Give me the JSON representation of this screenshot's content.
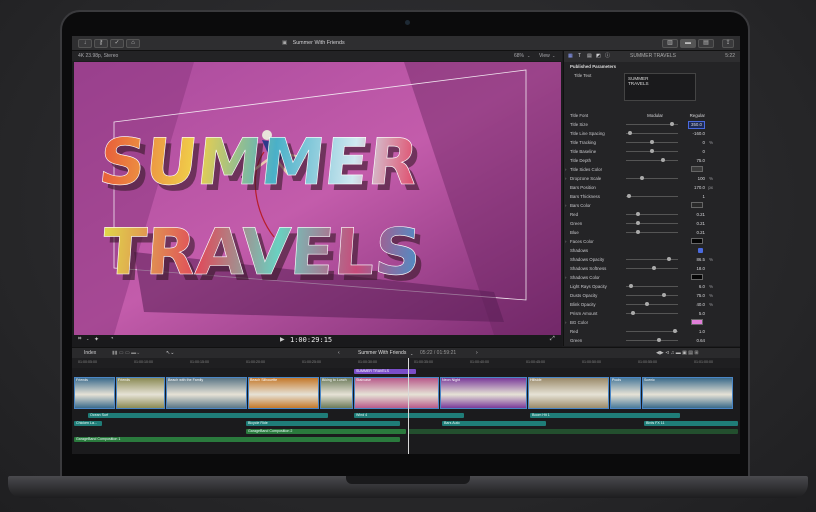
{
  "toolbar": {
    "project_title": "Summer With Friends",
    "format": "4K 23.98p, Stereo",
    "zoom": "68%",
    "view_label": "View",
    "inspector_title": "SUMMER TRAVELS",
    "inspector_time": "5:22"
  },
  "viewer": {
    "title_line1": "SUMMER",
    "title_line2": "TRAVELS",
    "timecode": "1:00:29:15"
  },
  "inspector": {
    "section": "Published Parameters",
    "title_text_label": "Title Text",
    "title_text_value": [
      "SUMMER",
      "TRAVELS"
    ],
    "rows": [
      {
        "label": "Title Font",
        "value": "Modular",
        "extra": "Regular"
      },
      {
        "label": "Title Size",
        "value": "350.0",
        "slider": 0.92
      },
      {
        "label": "Title Line Spacing",
        "value": "-160.0",
        "slider": 0.05
      },
      {
        "label": "Title Tracking",
        "value": "0",
        "unit": "%",
        "slider": 0.5
      },
      {
        "label": "Title Baseline",
        "value": "0",
        "slider": 0.5
      },
      {
        "label": "Title Depth",
        "value": "75.0",
        "slider": 0.72
      },
      {
        "label": "Title Sides Color",
        "swatch": "#3a3a3a",
        "disclosure": true
      },
      {
        "label": "Dropzone Scale",
        "value": "100",
        "unit": "%",
        "slider": 0.3,
        "disclosure": true
      },
      {
        "label": "Bars Position",
        "value": "170.0",
        "unit": "px"
      },
      {
        "label": "Bars Thickness",
        "value": "1",
        "slider": 0.02
      },
      {
        "label": "Bars Color",
        "swatch": "#2a2a2a",
        "disclosure": true
      },
      {
        "label": "Red",
        "value": "0.21",
        "slider": 0.21
      },
      {
        "label": "Green",
        "value": "0.21",
        "slider": 0.21
      },
      {
        "label": "Blue",
        "value": "0.21",
        "slider": 0.21
      },
      {
        "label": "Faces Color",
        "swatch": "#050505",
        "disclosure": true
      },
      {
        "label": "Shadows",
        "checkbox": true
      },
      {
        "label": "Shadows Opacity",
        "value": "86.5",
        "unit": "%",
        "slider": 0.86
      },
      {
        "label": "Shadows Softness",
        "value": "18.0",
        "slider": 0.55
      },
      {
        "label": "Shadows Color",
        "swatch": "#050505",
        "disclosure": true
      },
      {
        "label": "Light Rays Opacity",
        "value": "6.0",
        "unit": "%",
        "slider": 0.06
      },
      {
        "label": "Dusts Opacity",
        "value": "75.0",
        "unit": "%",
        "slider": 0.75
      },
      {
        "label": "Blink Opacity",
        "value": "40.0",
        "unit": "%",
        "slider": 0.4
      },
      {
        "label": "Prism Amount",
        "value": "5.0",
        "slider": 0.1
      },
      {
        "label": "BG Color",
        "swatch": "#e07fd8",
        "disclosure": true
      },
      {
        "label": "Red",
        "value": "1.0",
        "slider": 0.98
      },
      {
        "label": "Green",
        "value": "0.64",
        "slider": 0.64
      }
    ]
  },
  "timeline": {
    "index_label": "Index",
    "project_name": "Summer With Friends",
    "duration": "05:22 / 01:59:21",
    "title_clip": "SUMMER TRAVELS",
    "ruler": [
      "01:00:05:00",
      "01:00:10:00",
      "01:00:15:00",
      "01:00:20:00",
      "01:00:25:00",
      "01:00:30:00",
      "01:00:35:00",
      "01:00:40:00",
      "01:00:45:00",
      "01:00:50:00",
      "01:00:55:00",
      "01:01:00:00"
    ],
    "video_clips": [
      {
        "label": "Friends",
        "color": "#3b6b8c"
      },
      {
        "label": "Friends",
        "color": "#8a8a55"
      },
      {
        "label": "Beach with the Family",
        "color": "#5a7686"
      },
      {
        "label": "Beach Silhouette",
        "color": "#c4782a"
      },
      {
        "label": "Biking to Lunch",
        "color": "#6c7a5a"
      },
      {
        "label": "Staircase",
        "color": "#b85a8a"
      },
      {
        "label": "Neon Night",
        "color": "#7a3a9a"
      },
      {
        "label": "Hillside",
        "color": "#9a8a6a"
      },
      {
        "label": "Pools",
        "color": "#4a7a9a"
      },
      {
        "label": "Scenic",
        "color": "#3a6a8a"
      }
    ],
    "audio_clips": [
      {
        "label": "Ocean Surf",
        "row": 0
      },
      {
        "label": "Wind 4",
        "row": 0
      },
      {
        "label": "Boom Hit 1",
        "row": 0
      },
      {
        "label": "Chicken La...",
        "row": 1
      },
      {
        "label": "Bicycle Ride",
        "row": 1
      },
      {
        "label": "Bars Auto",
        "row": 1
      },
      {
        "label": "Birds FX 11",
        "row": 1
      },
      {
        "label": "GarageBand Composition 2",
        "row": 2
      },
      {
        "label": "GarageBand Composition 1",
        "row": 3
      }
    ]
  }
}
